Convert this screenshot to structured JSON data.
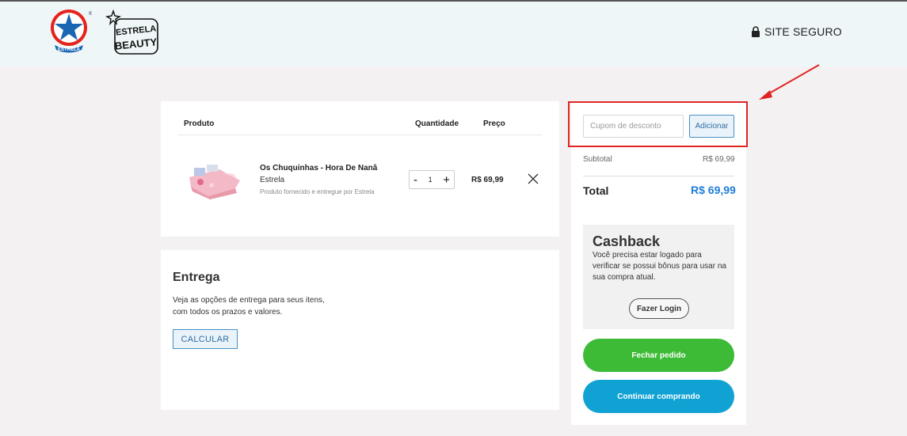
{
  "header": {
    "logo_estrela_text": "ESTRELA",
    "logo_beauty_line1": "ESTRELA",
    "logo_beauty_line2": "BEAUTY",
    "secure_label": "SITE SEGURO"
  },
  "cart": {
    "columns": {
      "product": "Produto",
      "quantity": "Quantidade",
      "price": "Preço"
    },
    "items": [
      {
        "name": "Os Chuquinhas - Hora De Nanâ",
        "brand": "Estrela",
        "seller": "Produto fornecido e entregue por Estrela",
        "quantity": "1",
        "minus": "-",
        "plus": "+",
        "price": "R$ 69,99"
      }
    ]
  },
  "shipping": {
    "title": "Entrega",
    "text_line1": "Veja as opções de entrega para seus itens,",
    "text_line2": "com todos os prazos e valores.",
    "calc_label": "CALCULAR"
  },
  "summary": {
    "coupon_placeholder": "Cupom de desconto",
    "coupon_add_label": "Adicionar",
    "subtotal_label": "Subtotal",
    "subtotal_value": "R$ 69,99",
    "total_label": "Total",
    "total_value": "R$ 69,99"
  },
  "cashback": {
    "title": "Cashback",
    "text": "Você precisa estar logado para verificar se possui bônus para usar na sua compra atual.",
    "login_label": "Fazer Login"
  },
  "actions": {
    "close_order_label": "Fechar pedido",
    "continue_label": "Continuar comprando"
  },
  "colors": {
    "header_bg": "#eef6f8",
    "page_bg": "#f3f1f1",
    "total_blue": "#1e7fd6",
    "close_order_green": "#3dbb36",
    "continue_blue": "#11a2d4",
    "annotation_red": "#e02424"
  }
}
